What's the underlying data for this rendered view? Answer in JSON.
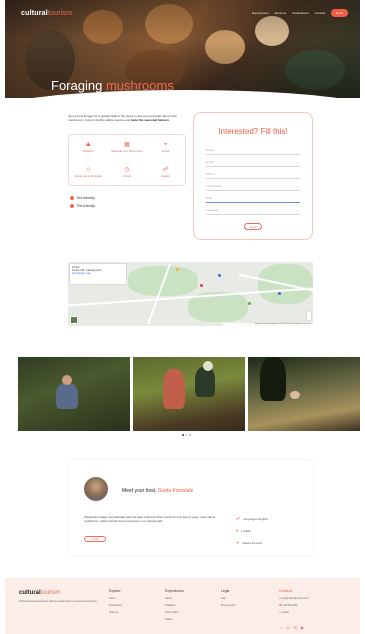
{
  "nav": {
    "logo_main": "cultural",
    "logo_accent": "tourism",
    "links": [
      "Experiences",
      "About us",
      "Destinations",
      "Contact"
    ],
    "cta": "Book"
  },
  "hero": {
    "title_main": "Foraging",
    "title_accent": "mushrooms"
  },
  "intro": {
    "text": "Join a local forager for a guided walk in the forest to discover and learn about wild mushrooms, how to identify edible species and",
    "bold": "taste the seasonal harvest."
  },
  "features": [
    {
      "icon": "hiking-icon",
      "glyph": "⛰",
      "label": "Outdoors"
    },
    {
      "icon": "calendar-icon",
      "glyph": "▦",
      "label": "Seasonal, from Sept to Nov"
    },
    {
      "icon": "location-icon",
      "glyph": "⌖",
      "label": "Forest"
    },
    {
      "icon": "group-icon",
      "glyph": "☺",
      "label": "Groups up to 10 people"
    },
    {
      "icon": "clock-icon",
      "glyph": "◷",
      "label": "3 hours"
    },
    {
      "icon": "language-icon",
      "glyph": "☍",
      "label": "English"
    }
  ],
  "checks": [
    "Kid friendly",
    "Pet friendly"
  ],
  "form": {
    "title": "Interested? Fill this!",
    "fields": [
      "Name",
      "Email",
      "Phone",
      "Participants",
      "Date",
      "Message"
    ],
    "submit": "Send"
  },
  "map": {
    "place": "Forest",
    "address": "Forest trail, meeting point",
    "link": "View larger map",
    "attribution": "Keyboard shortcuts  Map data ©2023  Terms of Use  Report a map error"
  },
  "photos": [
    "forager-in-woods",
    "group-foraging",
    "mushroom-close-up"
  ],
  "host": {
    "title_main": "Meet your host,",
    "title_accent": "Guida Forestale",
    "description": "Passionate forager and naturalist who has been exploring these woods for over twenty years. Learn about mushrooms, plants and the forest ecosystem on a relaxed walk.",
    "button": "Contact",
    "facts": [
      {
        "icon": "language-icon",
        "glyph": "☍",
        "text": "Languages: English"
      },
      {
        "icon": "location-icon",
        "glyph": "⌖",
        "text": "Locality"
      },
      {
        "icon": "star-icon",
        "glyph": "✦",
        "text": "Nature & Forest"
      }
    ]
  },
  "footer": {
    "logo_main": "cultural",
    "logo_accent": "tourism",
    "description": "Authentic local experiences with the people who live and love the territory.",
    "col1": {
      "title": "Explore",
      "items": [
        "Home",
        "Experiences",
        "About us"
      ]
    },
    "col2": {
      "title": "Experiences",
      "items": [
        "Nature",
        "Traditions",
        "Food & Wine",
        "Culture"
      ]
    },
    "col3": {
      "title": "Legal",
      "items": [
        "FAQ",
        "Privacy policy"
      ]
    },
    "col4": {
      "title": "Contacts",
      "items": [
        "info@culturaltourism.com",
        "+39 000 0000",
        "Locality"
      ]
    }
  },
  "colors": {
    "accent": "#ef5b44",
    "footer_bg": "#fbeee9"
  }
}
